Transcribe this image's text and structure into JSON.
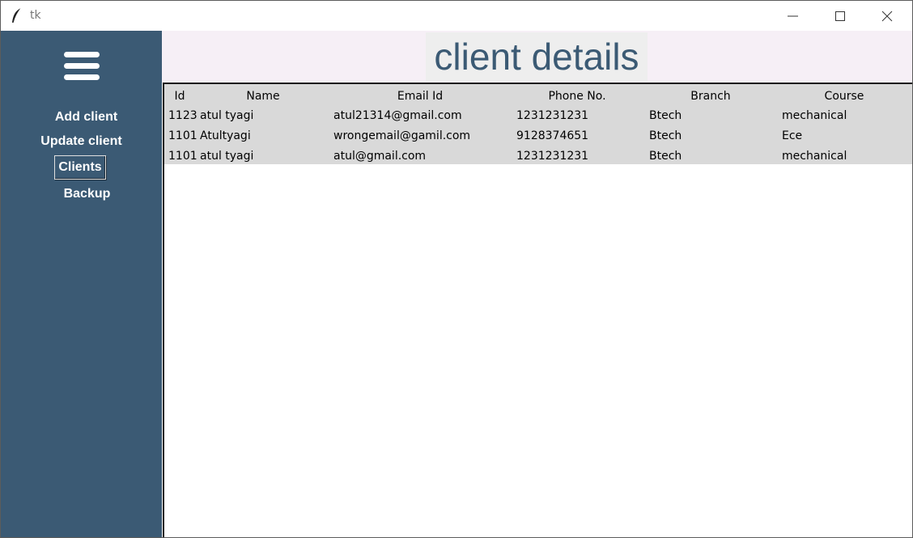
{
  "window": {
    "title": "tk"
  },
  "sidebar": {
    "menu_icon": "hamburger-menu-icon",
    "items": [
      {
        "label": "Add client"
      },
      {
        "label": "Update client"
      },
      {
        "label": "Clients",
        "selected": true
      },
      {
        "label": "Backup"
      }
    ]
  },
  "main": {
    "title": "client details"
  },
  "table": {
    "columns": [
      "Id",
      "Name",
      "Email Id",
      "Phone No.",
      "Branch",
      "Course"
    ],
    "rows": [
      [
        "1123",
        "atul tyagi",
        "atul21314@gmail.com",
        "1231231231",
        "Btech",
        "mechanical"
      ],
      [
        "1101",
        "Atultyagi",
        "wrongemail@gamil.com",
        "9128374651",
        "Btech",
        "Ece"
      ],
      [
        "1101",
        "atul tyagi",
        "atul@gmail.com",
        "1231231231",
        "Btech",
        "mechanical"
      ]
    ]
  },
  "colors": {
    "sidebar_bg": "#3b5a74",
    "title_text": "#3b5a74",
    "header_bg": "#f6eff6",
    "table_bg": "#d9d9d9"
  }
}
